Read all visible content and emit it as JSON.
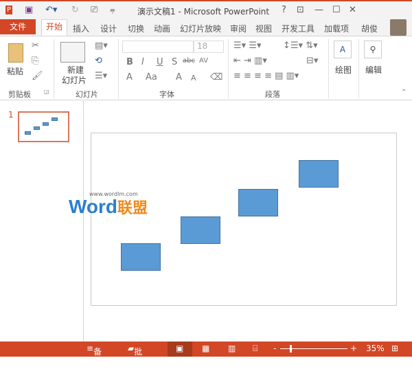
{
  "title": "演示文稿1 - Microsoft PowerPoint",
  "window_controls": {
    "help": "?",
    "restore_ribbon": "⊡",
    "minimize": "—",
    "maximize": "☐",
    "close": "✕"
  },
  "tabs": {
    "file": "文件",
    "items": [
      "开始",
      "插入",
      "设计",
      "切换",
      "动画",
      "幻灯片放映",
      "审阅",
      "视图",
      "开发工具",
      "加载项"
    ],
    "user": "胡俊"
  },
  "ribbon": {
    "clipboard": {
      "paste": "粘贴",
      "label": "剪贴板"
    },
    "slides": {
      "new_slide_1": "新建",
      "new_slide_2": "幻灯片",
      "label": "幻灯片"
    },
    "font": {
      "font_size": "18",
      "bold": "B",
      "italic": "I",
      "underline": "U",
      "shadow": "S",
      "strike": "abc",
      "spacing": "AV",
      "aa": "Aa",
      "grow": "A",
      "shrink": "A",
      "color": "A",
      "label": "字体"
    },
    "paragraph": {
      "label": "段落"
    },
    "drawing": {
      "label": "绘图"
    },
    "editing": {
      "label": "编辑"
    }
  },
  "slide_panel": {
    "number": "1"
  },
  "watermark": {
    "url": "www.wordlm.com",
    "brand1": "Word",
    "brand2": "联盟"
  },
  "status": {
    "notes": "备注",
    "comments": "批注",
    "zoom_minus": "-",
    "zoom_plus": "+",
    "zoom": "35%",
    "zoom_fraction": 0.35
  },
  "colors": {
    "accent": "#d24726",
    "shape": "#5b9bd5"
  }
}
